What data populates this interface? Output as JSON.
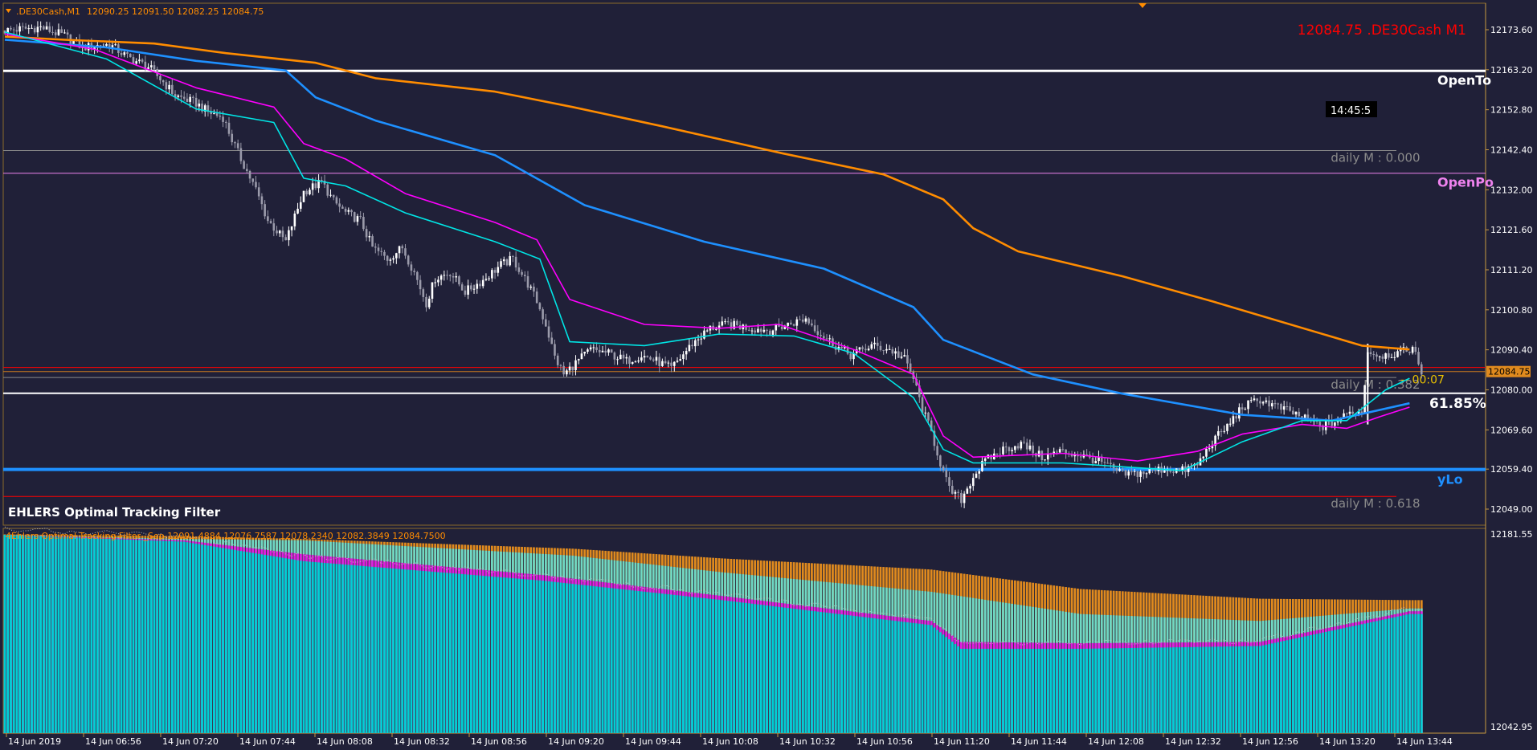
{
  "header": {
    "symbol_label": ".DE30Cash,M1",
    "ohlc": "12090.25 12091.50 12082.25 12084.75",
    "price_big": "12084.75 .DE30Cash M1",
    "timer": "14:45:5",
    "indicator_title": "EHLERS Optimal Tracking Filter",
    "sub_header": "4Ehlers Optimal Tracking Filter _Sep 12091.4884 12076.7587 12078.2340 12082.3849 12084.7500"
  },
  "levels": [
    {
      "name": "open-today",
      "label": "OpenTo",
      "color": "#ffffff",
      "price": 12162.9
    },
    {
      "name": "daily-m-0",
      "label": "daily M : 0.000",
      "color": "#8a8a8a",
      "price": 12142.2
    },
    {
      "name": "open-prev",
      "label": "OpenPo",
      "color": "#ee82ee",
      "price": 12136.3
    },
    {
      "name": "red-upper",
      "label": "",
      "color": "#ff0000",
      "price": 12085.8
    },
    {
      "name": "daily-m-382",
      "label": "daily M : 0.382",
      "color": "#8a8a8a",
      "price": 12083.2
    },
    {
      "name": "fib-6185",
      "label": "61.85%",
      "color": "#ffffff",
      "price": 12079.1
    },
    {
      "name": "y-low",
      "label": "yLo",
      "color": "#1e90ff",
      "price": 12059.3
    },
    {
      "name": "daily-m-618",
      "label": "daily M : 0.618",
      "color": "#ff0000",
      "price": 12052.3
    }
  ],
  "countdown": "00:07",
  "price_tag": "12084.75",
  "chart_data": [
    {
      "type": "candlestick",
      "title": ".DE30Cash,M1",
      "ylim": [
        12045.8,
        12179.4
      ],
      "y_ticks": [
        12173.6,
        12163.2,
        12152.8,
        12142.4,
        12132.0,
        12121.6,
        12111.2,
        12100.8,
        12090.4,
        12080.0,
        12069.6,
        12059.4,
        12049.0
      ],
      "x_ticks": [
        "14 Jun 2019",
        "14 Jun 06:56",
        "14 Jun 07:20",
        "14 Jun 07:44",
        "14 Jun 08:08",
        "14 Jun 08:32",
        "14 Jun 08:56",
        "14 Jun 09:20",
        "14 Jun 09:44",
        "14 Jun 10:08",
        "14 Jun 10:32",
        "14 Jun 10:56",
        "14 Jun 11:20",
        "14 Jun 11:44",
        "14 Jun 12:08",
        "14 Jun 12:32",
        "14 Jun 12:56",
        "14 Jun 13:20",
        "14 Jun 13:44"
      ],
      "close_path": [
        [
          0,
          12173.4
        ],
        [
          12,
          12174.2
        ],
        [
          20,
          12172.0
        ],
        [
          26,
          12169.0
        ],
        [
          35,
          12169.8
        ],
        [
          41,
          12166.5
        ],
        [
          48,
          12164.0
        ],
        [
          53,
          12160.0
        ],
        [
          57,
          12156.5
        ],
        [
          64,
          12154.5
        ],
        [
          68,
          12152.2
        ],
        [
          73,
          12150.8
        ],
        [
          76,
          12145.0
        ],
        [
          79,
          12140.0
        ],
        [
          84,
          12132.0
        ],
        [
          88,
          12124.0
        ],
        [
          94,
          12118.5
        ],
        [
          100,
          12131.5
        ],
        [
          106,
          12134.0
        ],
        [
          110,
          12129.0
        ],
        [
          114,
          12126.0
        ],
        [
          119,
          12124.0
        ],
        [
          123,
          12117.0
        ],
        [
          128,
          12114.0
        ],
        [
          133,
          12117.0
        ],
        [
          137,
          12110.5
        ],
        [
          141,
          12102.5
        ],
        [
          144,
          12109.0
        ],
        [
          149,
          12110.5
        ],
        [
          154,
          12105.5
        ],
        [
          160,
          12108.5
        ],
        [
          166,
          12112.5
        ],
        [
          170,
          12114.0
        ],
        [
          175,
          12107.5
        ],
        [
          178,
          12103.0
        ],
        [
          181,
          12097.0
        ],
        [
          184,
          12088.5
        ],
        [
          187,
          12084.0
        ],
        [
          191,
          12087.0
        ],
        [
          196,
          12090.5
        ],
        [
          202,
          12089.5
        ],
        [
          208,
          12087.5
        ],
        [
          213,
          12089.0
        ],
        [
          218,
          12087.5
        ],
        [
          223,
          12085.5
        ],
        [
          230,
          12092.0
        ],
        [
          236,
          12096.0
        ],
        [
          242,
          12097.0
        ],
        [
          250,
          12096.0
        ],
        [
          256,
          12095.5
        ],
        [
          262,
          12097.0
        ],
        [
          268,
          12098.5
        ],
        [
          273,
          12094.5
        ],
        [
          278,
          12091.5
        ],
        [
          283,
          12089.0
        ],
        [
          290,
          12091.5
        ],
        [
          296,
          12090.5
        ],
        [
          301,
          12088.0
        ],
        [
          304,
          12083.0
        ],
        [
          307,
          12075.0
        ],
        [
          310,
          12069.0
        ],
        [
          313,
          12061.0
        ],
        [
          316,
          12054.0
        ],
        [
          320,
          12051.5
        ],
        [
          324,
          12057.5
        ],
        [
          328,
          12061.5
        ],
        [
          334,
          12064.5
        ],
        [
          340,
          12066.0
        ],
        [
          347,
          12062.5
        ],
        [
          353,
          12064.0
        ],
        [
          360,
          12063.0
        ],
        [
          366,
          12061.5
        ],
        [
          374,
          12058.0
        ],
        [
          381,
          12058.5
        ],
        [
          388,
          12059.5
        ],
        [
          394,
          12059.0
        ],
        [
          399,
          12060.5
        ],
        [
          404,
          12066.5
        ],
        [
          409,
          12070.5
        ],
        [
          414,
          12075.5
        ],
        [
          420,
          12077.5
        ],
        [
          426,
          12075.5
        ],
        [
          431,
          12074.0
        ],
        [
          436,
          12072.0
        ],
        [
          441,
          12070.5
        ],
        [
          446,
          12072.0
        ],
        [
          451,
          12074.5
        ],
        [
          454,
          12074.0
        ],
        [
          456,
          12090.0
        ],
        [
          460,
          12089.0
        ],
        [
          466,
          12089.5
        ],
        [
          471,
          12091.0
        ],
        [
          474,
          12084.75
        ]
      ],
      "series": [
        {
          "name": "orange-ma",
          "color": "#ff8c00",
          "points": [
            [
              0,
              12171.8
            ],
            [
              20,
              12171.0
            ],
            [
              50,
              12170.0
            ],
            [
              74,
              12167.5
            ],
            [
              104,
              12165.0
            ],
            [
              124,
              12161.0
            ],
            [
              164,
              12157.5
            ],
            [
              190,
              12153.5
            ],
            [
              220,
              12148.5
            ],
            [
              260,
              12141.5
            ],
            [
              294,
              12136.0
            ],
            [
              314,
              12129.5
            ],
            [
              324,
              12122.0
            ],
            [
              339,
              12116.0
            ],
            [
              374,
              12109.5
            ],
            [
              404,
              12103.0
            ],
            [
              454,
              12091.5
            ],
            [
              470,
              12090.5
            ]
          ]
        },
        {
          "name": "blue-ma",
          "color": "#1e90ff",
          "points": [
            [
              0,
              12171.0
            ],
            [
              34,
              12169.0
            ],
            [
              64,
              12165.5
            ],
            [
              94,
              12163.0
            ],
            [
              104,
              12156.0
            ],
            [
              124,
              12150.0
            ],
            [
              164,
              12141.0
            ],
            [
              194,
              12128.0
            ],
            [
              234,
              12118.5
            ],
            [
              274,
              12111.5
            ],
            [
              304,
              12101.5
            ],
            [
              314,
              12093.0
            ],
            [
              344,
              12084.0
            ],
            [
              374,
              12079.0
            ],
            [
              414,
              12073.5
            ],
            [
              444,
              12072.0
            ],
            [
              470,
              12076.5
            ]
          ]
        },
        {
          "name": "magenta-ma",
          "color": "#ff00ff",
          "points": [
            [
              0,
              12172.5
            ],
            [
              30,
              12168.5
            ],
            [
              64,
              12158.5
            ],
            [
              90,
              12153.5
            ],
            [
              100,
              12144.0
            ],
            [
              114,
              12140.0
            ],
            [
              134,
              12131.0
            ],
            [
              164,
              12123.5
            ],
            [
              178,
              12119.0
            ],
            [
              189,
              12103.5
            ],
            [
              214,
              12097.0
            ],
            [
              239,
              12096.0
            ],
            [
              259,
              12097.0
            ],
            [
              284,
              12090.5
            ],
            [
              304,
              12084.0
            ],
            [
              314,
              12068.0
            ],
            [
              324,
              12062.5
            ],
            [
              354,
              12063.5
            ],
            [
              379,
              12061.5
            ],
            [
              399,
              12064.0
            ],
            [
              414,
              12068.5
            ],
            [
              434,
              12071.0
            ],
            [
              449,
              12070.0
            ],
            [
              460,
              12073.0
            ],
            [
              470,
              12075.5
            ]
          ]
        },
        {
          "name": "cyan-ma",
          "color": "#00e5e5",
          "points": [
            [
              0,
              12173.0
            ],
            [
              34,
              12166.0
            ],
            [
              64,
              12153.0
            ],
            [
              90,
              12149.5
            ],
            [
              100,
              12135.0
            ],
            [
              114,
              12133.0
            ],
            [
              134,
              12126.0
            ],
            [
              164,
              12118.5
            ],
            [
              179,
              12114.0
            ],
            [
              189,
              12092.5
            ],
            [
              214,
              12091.5
            ],
            [
              239,
              12094.5
            ],
            [
              264,
              12094.0
            ],
            [
              284,
              12089.5
            ],
            [
              304,
              12078.0
            ],
            [
              314,
              12064.5
            ],
            [
              324,
              12061.0
            ],
            [
              354,
              12061.0
            ],
            [
              394,
              12059.0
            ],
            [
              414,
              12066.5
            ],
            [
              434,
              12072.0
            ],
            [
              449,
              12072.0
            ],
            [
              462,
              12080.0
            ],
            [
              470,
              12083.0
            ]
          ]
        }
      ]
    },
    {
      "type": "area",
      "title": "4Ehlers Optimal Tracking Filter _Sep",
      "ylim": [
        12042.95,
        12181.55
      ],
      "y_ticks": [
        12181.55,
        12042.95
      ],
      "series": [
        {
          "name": "cyan",
          "color": "#00cfd4",
          "points": [
            [
              0,
              12181.0
            ],
            [
              60,
              12176.0
            ],
            [
              100,
              12162.0
            ],
            [
              180,
              12148.0
            ],
            [
              240,
              12134.0
            ],
            [
              310,
              12116.0
            ],
            [
              320,
              12099.0
            ],
            [
              360,
              12099.0
            ],
            [
              420,
              12101.0
            ],
            [
              470,
              12124.0
            ]
          ]
        },
        {
          "name": "magenta",
          "color": "#e01ce0",
          "points": [
            [
              0,
              12181.0
            ],
            [
              60,
              12177.0
            ],
            [
              100,
              12167.0
            ],
            [
              180,
              12152.0
            ],
            [
              240,
              12137.0
            ],
            [
              310,
              12119.0
            ],
            [
              320,
              12104.0
            ],
            [
              360,
              12103.0
            ],
            [
              420,
              12104.0
            ],
            [
              470,
              12126.0
            ]
          ]
        },
        {
          "name": "aquamarine",
          "color": "#6fd8c4",
          "points": [
            [
              0,
              12181.0
            ],
            [
              60,
              12178.0
            ],
            [
              100,
              12177.0
            ],
            [
              190,
              12166.0
            ],
            [
              240,
              12154.0
            ],
            [
              310,
              12140.0
            ],
            [
              360,
              12124.0
            ],
            [
              420,
              12119.0
            ],
            [
              470,
              12128.0
            ]
          ]
        },
        {
          "name": "orange",
          "color": "#e08a1e",
          "points": [
            [
              0,
              12181.3
            ],
            [
              60,
              12180.0
            ],
            [
              100,
              12178.0
            ],
            [
              190,
              12171.0
            ],
            [
              240,
              12164.0
            ],
            [
              310,
              12156.0
            ],
            [
              360,
              12142.0
            ],
            [
              420,
              12135.0
            ],
            [
              470,
              12134.0
            ]
          ]
        }
      ]
    }
  ]
}
